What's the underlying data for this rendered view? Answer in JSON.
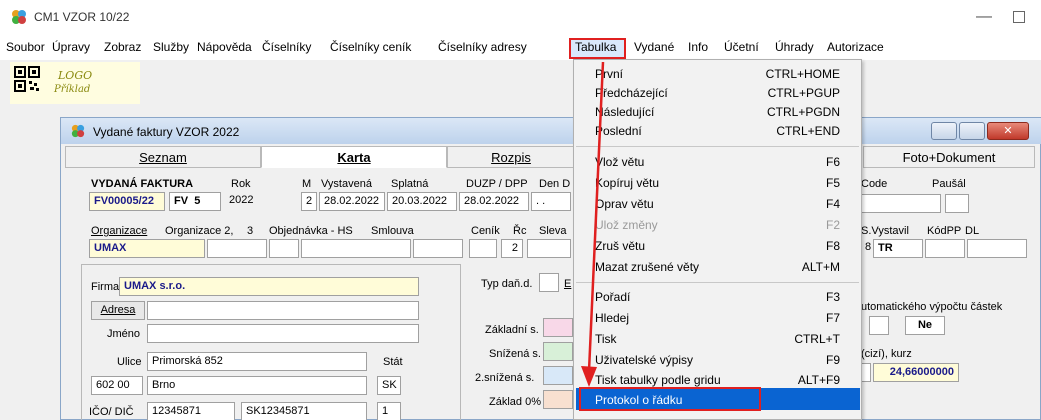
{
  "window": {
    "title": "CM1 VZOR 10/22"
  },
  "menubar": [
    "Soubor",
    "Úpravy",
    "Zobraz",
    "Služby",
    "Nápověda",
    "Číselníky",
    "Číselníky ceník",
    "Číselníky adresy",
    "Tabulka",
    "Vydané",
    "Info",
    "Účetní",
    "Úhrady",
    "Autorizace"
  ],
  "logo": {
    "line1": "LOGO",
    "line2": "Příklad"
  },
  "child": {
    "title": "Vydané faktury VZOR  2022",
    "tabs": [
      "Seznam",
      "Karta",
      "Rozpis",
      "Foto+Dokument"
    ],
    "labels": {
      "vydana": "VYDANÁ FAKTURA",
      "rok": "Rok",
      "m": "M",
      "vystavena": "Vystavená",
      "splatna": "Splatná",
      "duzp": "DUZP / DPP",
      "dend": "Den D",
      "code": "Code",
      "pausal": "Paušál",
      "organizace": "Organizace",
      "organizace2": "Organizace 2,",
      "org3": "3",
      "objednavka": "Objednávka - HS",
      "smlouva": "Smlouva",
      "cenik": "Ceník",
      "rc": "Řc",
      "sleva": "Sleva",
      "sv": "S.Vystavil",
      "kodpp": "KódPP",
      "dl": "DL",
      "firma": "Firma",
      "adresa": "Adresa",
      "jmeno": "Jméno",
      "ulice": "Ulice",
      "stat": "Stát",
      "icodic": "IČO/ DIČ",
      "typdan": "Typ daň.d.",
      "typdan_val": "E",
      "zakladni": "Základní s.",
      "snizena": "Snížená s.",
      "snizena2": "2.snížená s.",
      "zaklad0": "Základ 0%",
      "auto": "utomatického výpočtu částek",
      "cizi": "(cizí), kurz"
    },
    "values": {
      "doklad": "FV00005/22",
      "rada": "FV",
      "rada_no": "5",
      "rok": "2022",
      "m": "2",
      "vystavena": "28.02.2022",
      "splatna": "20.03.2022",
      "duzp": "28.02.2022",
      "dend": ". .",
      "org": "UMAX",
      "rc": "2",
      "sv_prefix": "8",
      "vystavil": "TR",
      "firma": "UMAX s.r.o.",
      "ulice": "Primorská 852",
      "psc": "602 00",
      "mesto": "Brno",
      "stat": "SK",
      "ico": "12345871",
      "dic": "SK12345871",
      "icodic_no": "1",
      "ne": "Ne",
      "kurz": "24,66000000"
    }
  },
  "dropdown": {
    "items": [
      {
        "label": "První",
        "shortcut": "CTRL+HOME"
      },
      {
        "label": "Předcházející",
        "shortcut": "CTRL+PGUP"
      },
      {
        "label": "Následující",
        "shortcut": "CTRL+PGDN"
      },
      {
        "label": "Poslední",
        "shortcut": "CTRL+END"
      },
      {
        "label": "Vlož větu",
        "shortcut": "F6"
      },
      {
        "label": "Kopíruj větu",
        "shortcut": "F5"
      },
      {
        "label": "Oprav větu",
        "shortcut": "F4"
      },
      {
        "label": "Ulož změny",
        "shortcut": "F2"
      },
      {
        "label": "Zruš větu",
        "shortcut": "F8"
      },
      {
        "label": "Mazat zrušené věty",
        "shortcut": "ALT+M"
      },
      {
        "label": "Pořadí",
        "shortcut": "F3"
      },
      {
        "label": "Hledej",
        "shortcut": "F7"
      },
      {
        "label": "Tisk",
        "shortcut": "CTRL+T"
      },
      {
        "label": "Uživatelské výpisy",
        "shortcut": "F9"
      },
      {
        "label": "Tisk tabulky podle gridu",
        "shortcut": "ALT+F9"
      },
      {
        "label": "Protokol o řádku",
        "shortcut": ""
      }
    ]
  },
  "colors": {
    "accent": "#0a64d2",
    "highlight_red": "#e02020",
    "yellow_field": "#fffcd8"
  }
}
